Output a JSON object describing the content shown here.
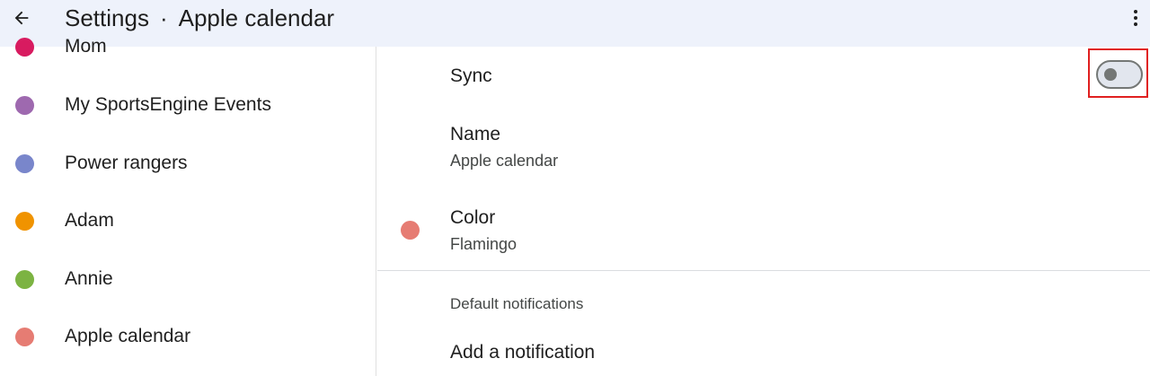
{
  "header": {
    "title": "Settings",
    "separator": "·",
    "subtitle": "Apple calendar",
    "back_icon": "arrow-back-icon",
    "more_icon": "more-vert-icon"
  },
  "sidebar": {
    "items": [
      {
        "label": "Mom",
        "color": "#d81b60"
      },
      {
        "label": "My SportsEngine Events",
        "color": "#9e69af"
      },
      {
        "label": "Power rangers",
        "color": "#7986cb"
      },
      {
        "label": "Adam",
        "color": "#f09300"
      },
      {
        "label": "Annie",
        "color": "#7cb342"
      },
      {
        "label": "Apple calendar",
        "color": "#e67c73"
      }
    ]
  },
  "settings": {
    "sync_label": "Sync",
    "sync_on": false,
    "name_label": "Name",
    "name_value": "Apple calendar",
    "color_label": "Color",
    "color_value": "Flamingo",
    "color_hex": "#e67c73",
    "default_notifications_header": "Default notifications",
    "add_notification_label": "Add a notification"
  },
  "highlight_color": "#e02020"
}
